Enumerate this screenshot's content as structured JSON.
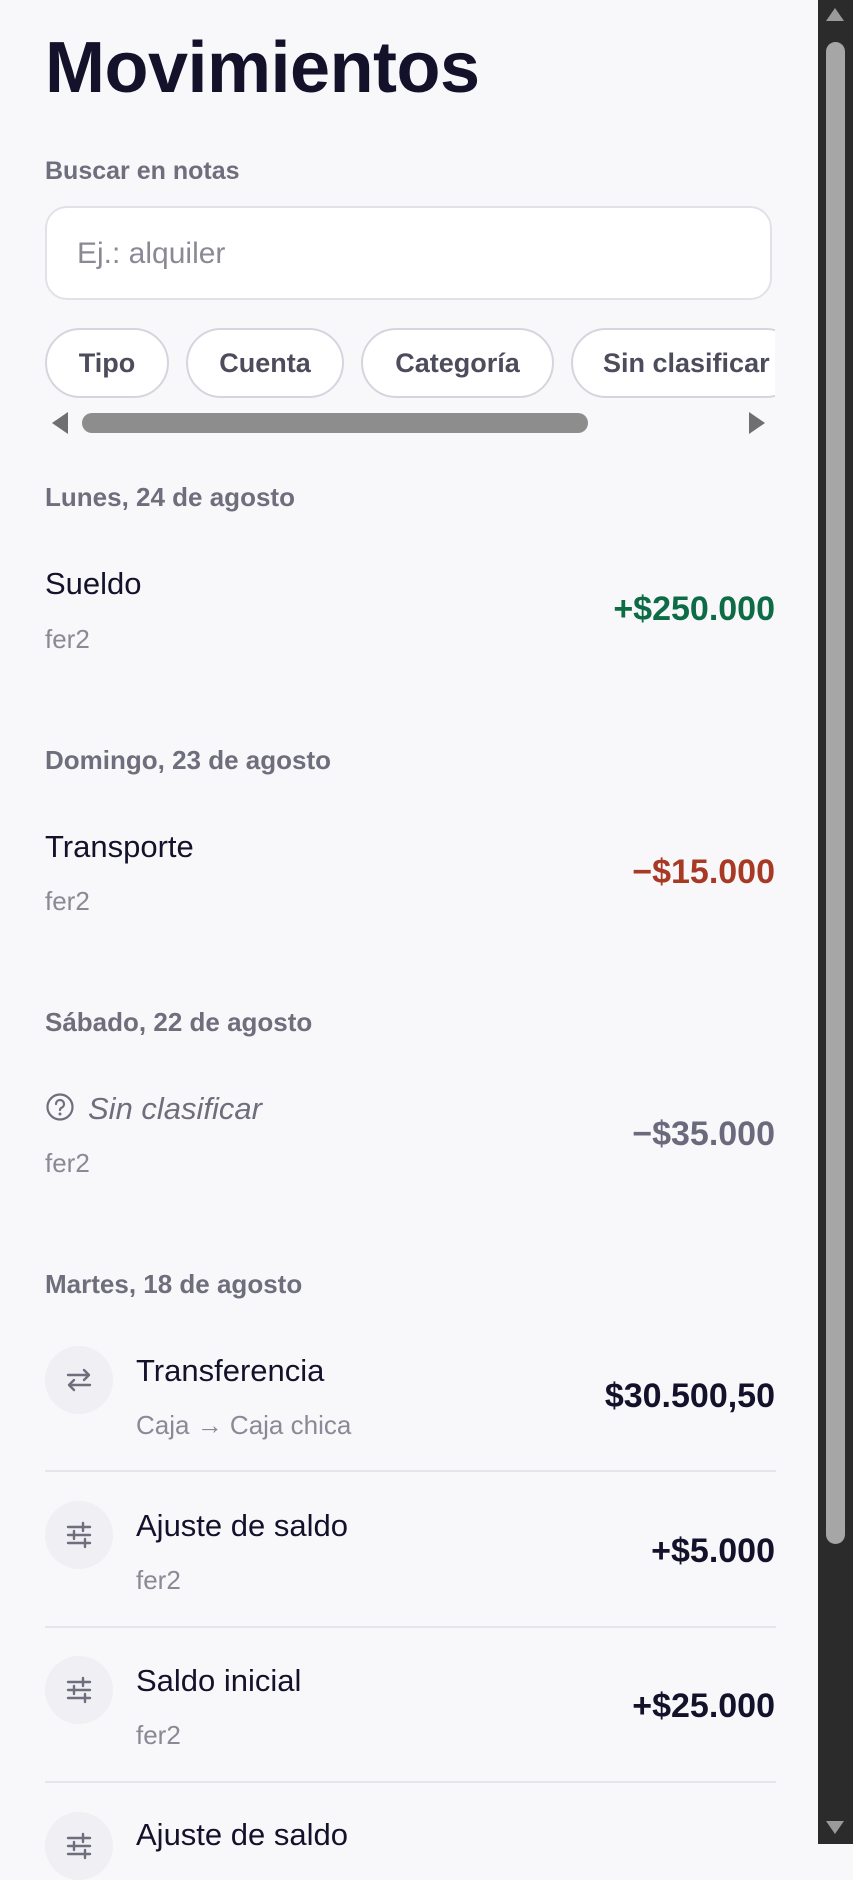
{
  "header": {
    "title": "Movimientos"
  },
  "search": {
    "label": "Buscar en notas",
    "placeholder": "Ej.: alquiler",
    "value": ""
  },
  "filters": [
    {
      "label": "Tipo"
    },
    {
      "label": "Cuenta"
    },
    {
      "label": "Categoría"
    },
    {
      "label": "Sin clasificar"
    }
  ],
  "colors": {
    "positive": "#0d6b45",
    "negative": "#a83a25",
    "neutral": "#6b6a7c",
    "text": "#14122b"
  },
  "groups": [
    {
      "date": "Lunes, 24 de agosto",
      "transactions": [
        {
          "title": "Sueldo",
          "subtitle": "fer2",
          "amount": "+$250.000"
        }
      ]
    },
    {
      "date": "Domingo, 23 de agosto",
      "transactions": [
        {
          "title": "Transporte",
          "subtitle": "fer2",
          "amount": "−$15.000"
        }
      ]
    },
    {
      "date": "Sábado, 22 de agosto",
      "transactions": [
        {
          "title": "Sin clasificar",
          "subtitle": "fer2",
          "amount": "−$35.000",
          "icon": "question-circle-icon"
        }
      ]
    },
    {
      "date": "Martes, 18 de agosto",
      "transactions": [
        {
          "title": "Transferencia",
          "subtitle": "Caja → Caja chica",
          "amount": "$30.500,50",
          "icon": "transfer-arrows-icon"
        },
        {
          "title": "Ajuste de saldo",
          "subtitle": "fer2",
          "amount": "+$5.000",
          "icon": "sliders-icon"
        },
        {
          "title": "Saldo inicial",
          "subtitle": "fer2",
          "amount": "+$25.000",
          "icon": "sliders-icon"
        },
        {
          "title": "Ajuste de saldo",
          "subtitle": "",
          "amount": "",
          "icon": "sliders-icon"
        }
      ]
    }
  ]
}
